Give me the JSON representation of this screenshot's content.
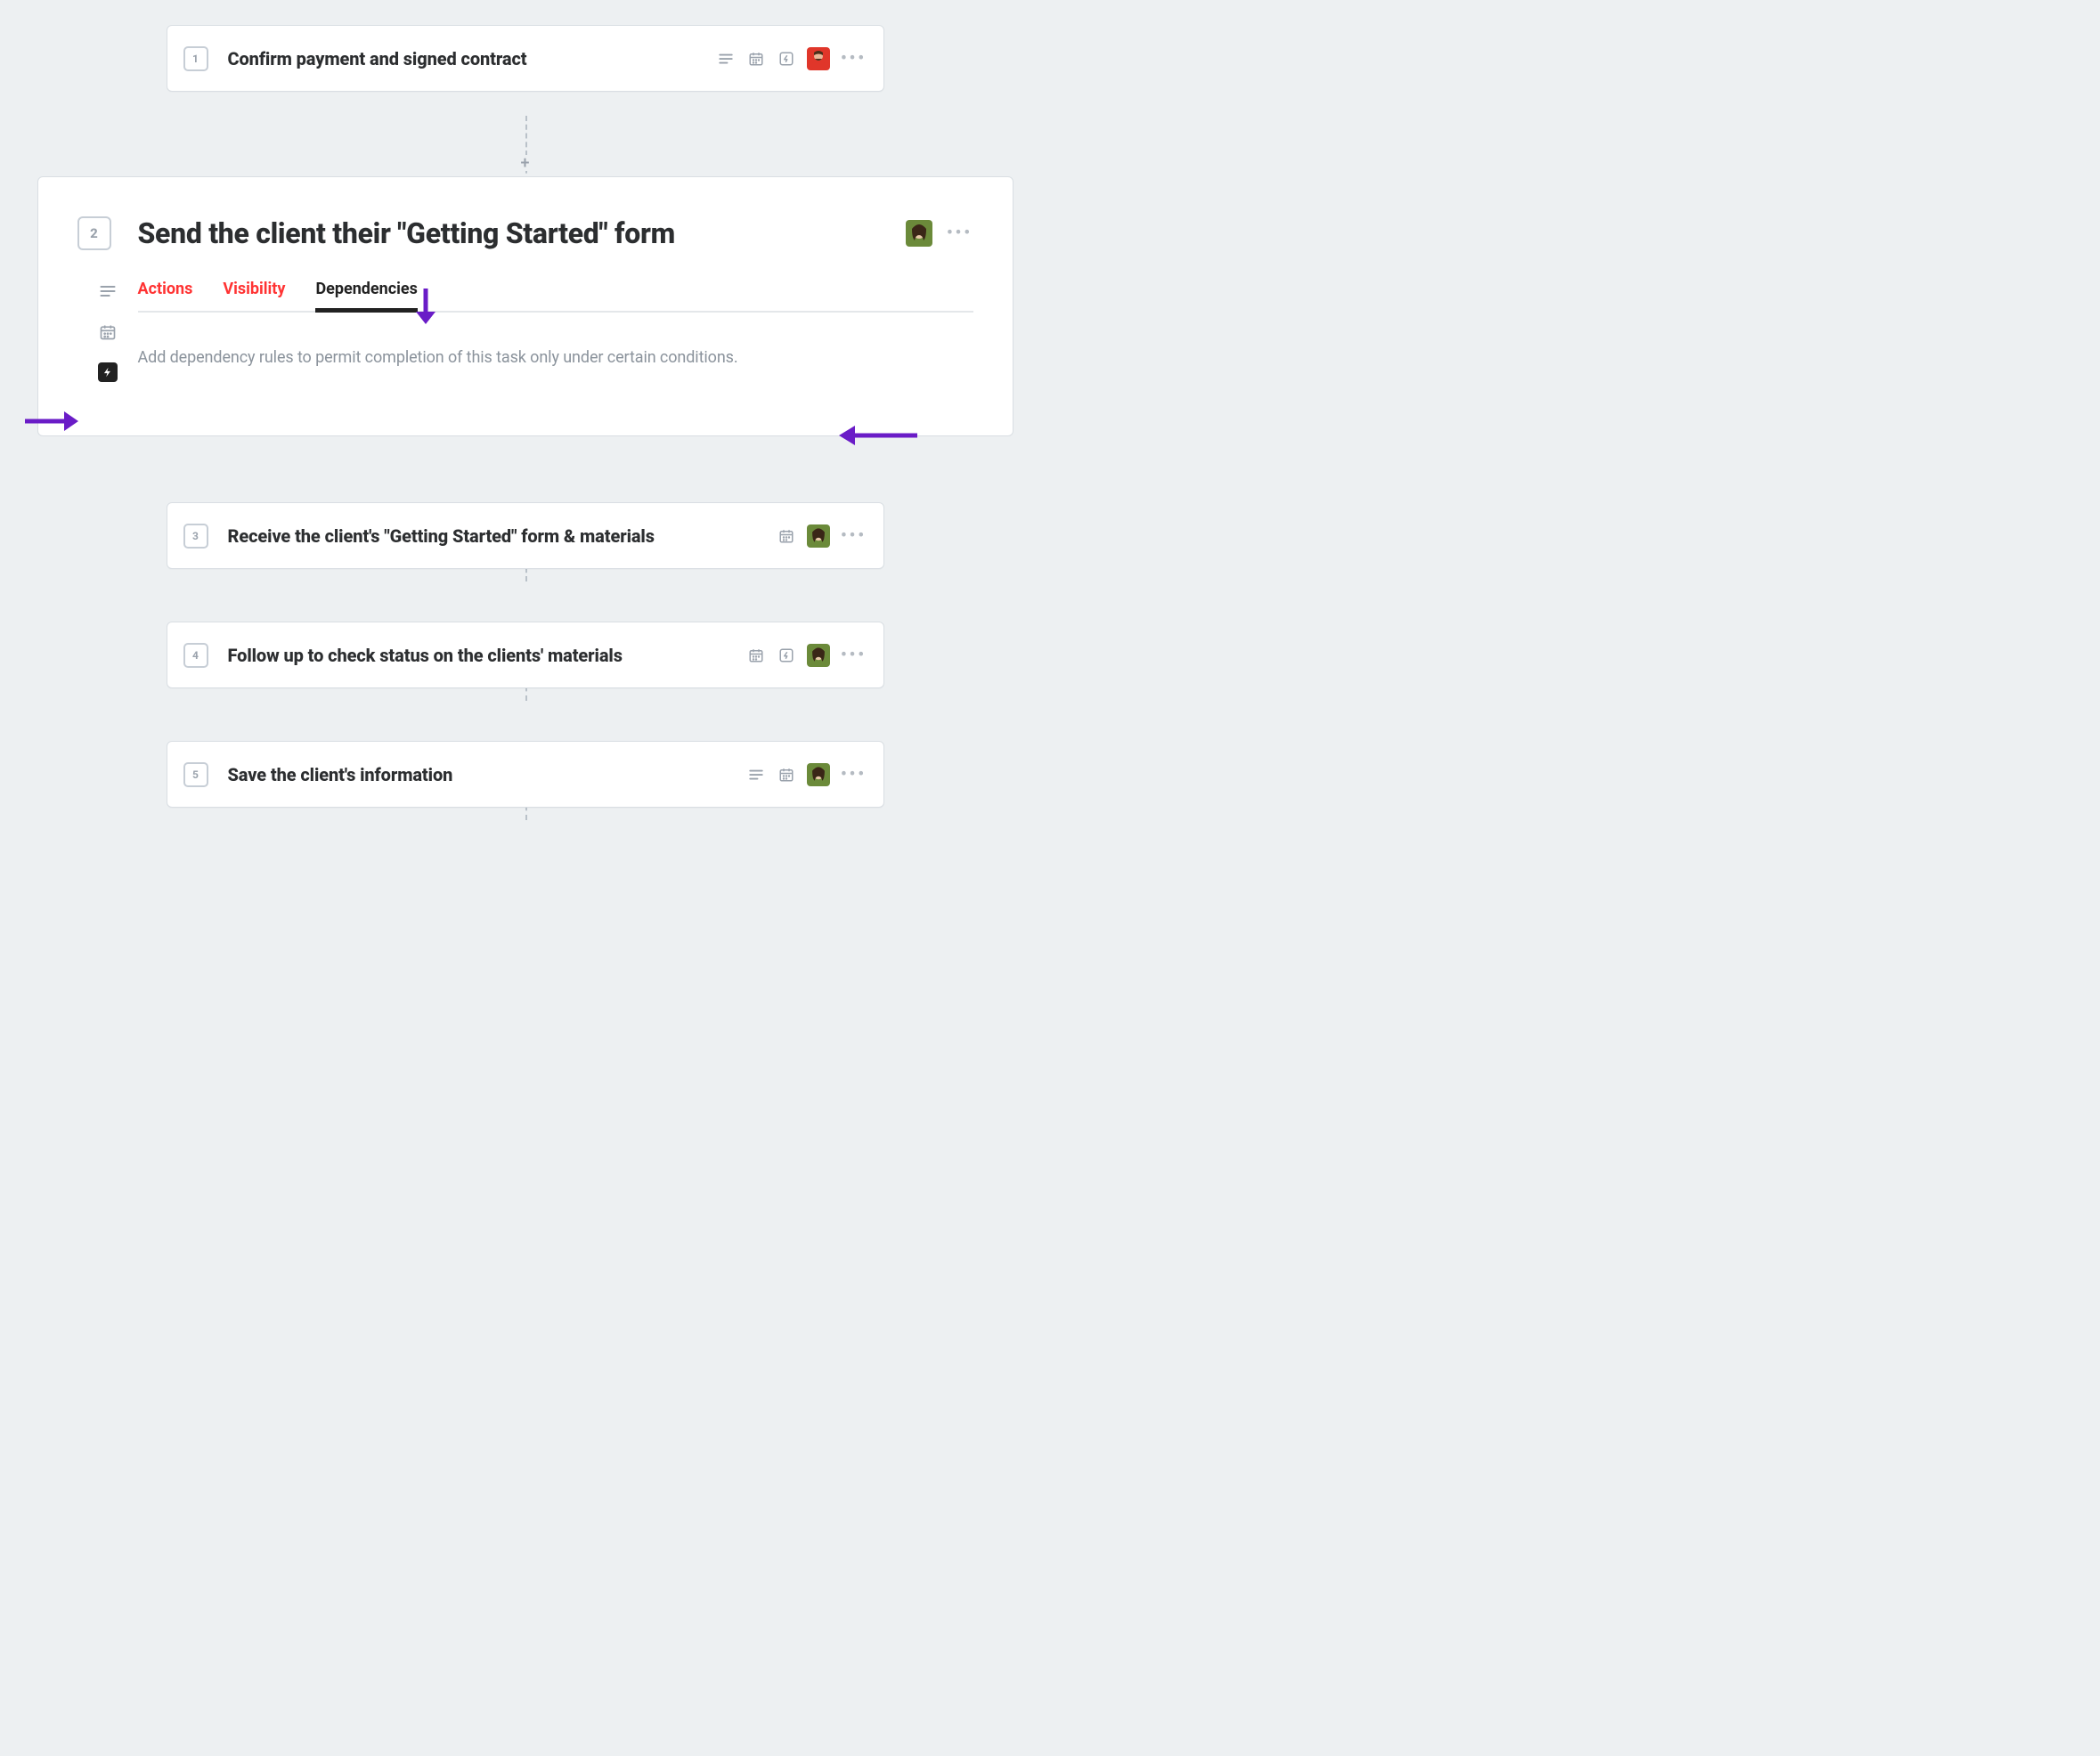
{
  "steps": [
    {
      "num": "1",
      "title": "Confirm payment and signed contract",
      "icons": {
        "desc": true,
        "cal": true,
        "bolt": true
      },
      "assignee": "user1"
    },
    {
      "num": "3",
      "title": "Receive the client's \"Getting Started\" form & materials",
      "icons": {
        "desc": false,
        "cal": true,
        "bolt": false
      },
      "assignee": "user2"
    },
    {
      "num": "4",
      "title": "Follow up to check status on the clients' materials",
      "icons": {
        "desc": false,
        "cal": true,
        "bolt": true
      },
      "assignee": "user2"
    },
    {
      "num": "5",
      "title": "Save the client's information",
      "icons": {
        "desc": true,
        "cal": true,
        "bolt": false
      },
      "assignee": "user2"
    }
  ],
  "expanded": {
    "num": "2",
    "title": "Send the client their \"Getting Started\" form",
    "assignee": "user2",
    "tabs": {
      "actions": "Actions",
      "visibility": "Visibility",
      "dependencies": "Dependencies"
    },
    "helper": "Add dependency rules to permit completion of this task only under certain conditions."
  },
  "glyphs": {
    "plus": "+",
    "dots": "•••"
  }
}
